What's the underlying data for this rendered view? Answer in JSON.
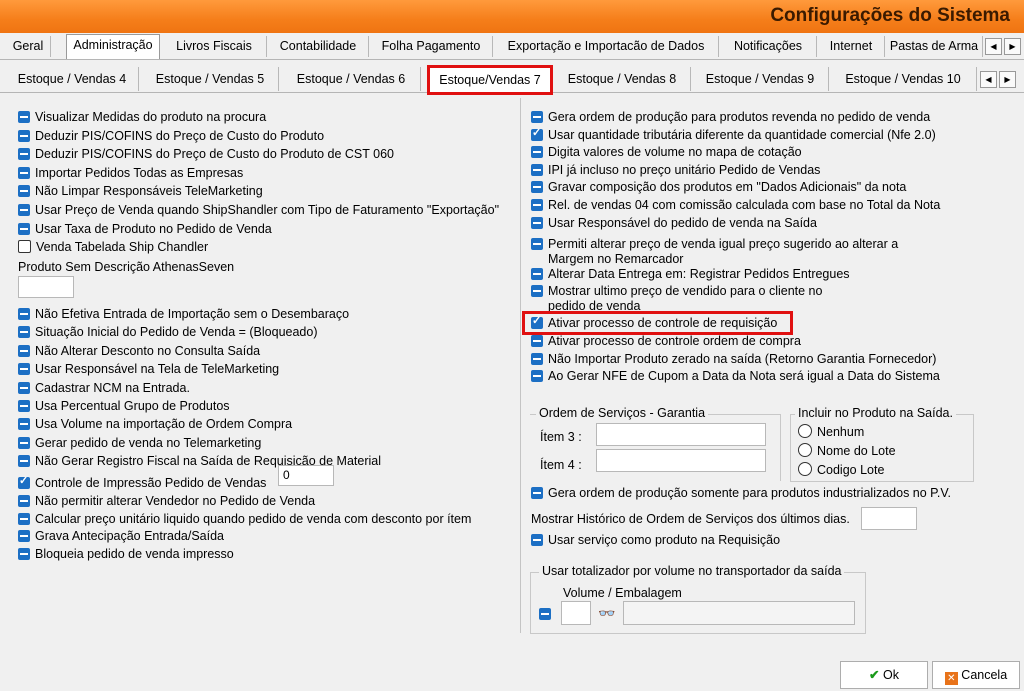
{
  "window": {
    "title": "Configurações do Sistema"
  },
  "tabs_row1": [
    "Geral",
    "Administração",
    "Livros Fiscais",
    "Contabilidade",
    "Folha Pagamento",
    "Exportação e Importacão de Dados",
    "Notificações",
    "Internet",
    "Pastas de Arma"
  ],
  "tabs_row2": [
    "Estoque / Vendas 4",
    "Estoque / Vendas 5",
    "Estoque / Vendas 6",
    "Estoque/Vendas 7",
    "Estoque / Vendas 8",
    "Estoque / Vendas 9",
    "Estoque / Vendas 10"
  ],
  "left": {
    "items_a": [
      "Visualizar Medidas do produto na procura",
      "Deduzir PIS/COFINS do Preço de Custo do Produto",
      "Deduzir PIS/COFINS do Preço de Custo do Produto de CST 060",
      "Importar Pedidos Todas as Empresas",
      "Não Limpar Responsáveis TeleMarketing",
      "Usar Preço de Venda quando ShipShandler com Tipo de Faturamento \"Exportação\"",
      "Usar Taxa de Produto no Pedido de Venda",
      "Venda Tabelada Ship Chandler"
    ],
    "produto_label": "Produto Sem Descrição AthenasSeven",
    "items_b": [
      "Não Efetiva Entrada de Importação sem o Desembaraço",
      "Situação Inicial do Pedido de Venda = (Bloqueado)",
      "Não Alterar Desconto no Consulta Saída",
      "Usar Responsável na Tela de TeleMarketing",
      "Cadastrar NCM na Entrada.",
      "Usa Percentual Grupo de Produtos",
      "Usa Volume na importação de Ordem Compra",
      "Gerar pedido de venda no Telemarketing",
      "Não Gerar Registro Fiscal na Saída de Requisição de Material"
    ],
    "controle_label": "Controle de Impressão Pedido de Vendas",
    "controle_value": "0",
    "items_c": [
      "Não permitir alterar Vendedor no Pedido de Venda",
      "Calcular preço unitário liquido quando pedido de venda com desconto por ítem",
      "Grava Antecipação Entrada/Saída",
      "Bloqueia pedido de venda impresso"
    ]
  },
  "right": {
    "items": [
      "Gera ordem de produção para produtos revenda no pedido de venda",
      "Usar quantidade tributária diferente da quantidade comercial (Nfe 2.0)",
      "Digita valores de volume no mapa de cotação",
      "IPI já incluso no preço unitário Pedido de Vendas",
      "Gravar composição dos produtos em \"Dados Adicionais\" da nota",
      "Rel. de vendas 04 com comissão calculada com base no Total da Nota",
      "Usar Responsável do pedido de venda na Saída"
    ],
    "permiti_l1": "Permiti alterar preço de venda igual preço sugerido ao alterar a",
    "permiti_l2": "Margem no Remarcador",
    "alterar_data": "Alterar Data Entrega em: Registrar Pedidos Entregues",
    "mostrar_l1": "Mostrar ultimo preço de vendido para o cliente no",
    "mostrar_l2": "pedido de venda",
    "ativar_req": "Ativar processo de controle de requisição",
    "items2": [
      "Ativar processo de controle ordem de compra",
      "Não Importar Produto zerado  na saída (Retorno Garantia Fornecedor)",
      "Ao Gerar NFE de Cupom a Data da Nota será igual a Data do Sistema"
    ],
    "os_group": {
      "title": "Ordem de Serviços - Garantia",
      "item3": "Ítem 3 :",
      "item4": "Ítem 4 :"
    },
    "incluir_group": {
      "title": "Incluir no Produto na Saída.",
      "options": [
        "Nenhum",
        "Nome do Lote",
        "Codigo Lote"
      ]
    },
    "gera_ind": "Gera ordem de produção somente para produtos industrializados no P.V.",
    "mostrar_hist": "Mostrar Histórico de Ordem de Serviços dos últimos  dias.",
    "usar_servico": "Usar serviço como produto na Requisição",
    "totalizador": {
      "title": "Usar totalizador por volume no transportador da saída",
      "col": "Volume / Embalagem"
    }
  },
  "buttons": {
    "ok": "Ok",
    "cancel": "Cancela"
  },
  "colors": {
    "title_bar": "#f57e1a",
    "checkbox": "#1c6fc4",
    "highlight": "#e01010"
  }
}
